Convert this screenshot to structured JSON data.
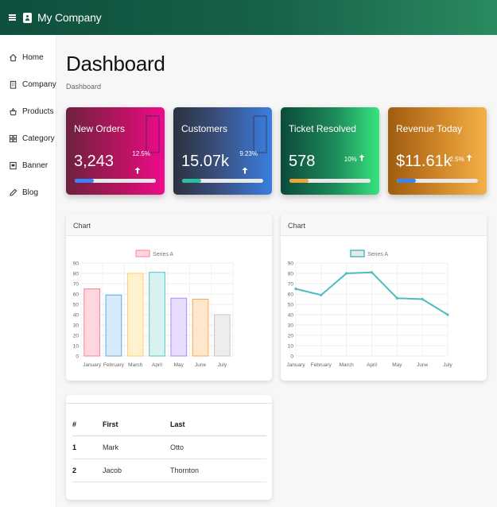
{
  "app": {
    "brand": "My Company"
  },
  "sidebar": {
    "items": [
      {
        "label": "Home",
        "icon": "home-icon"
      },
      {
        "label": "Company",
        "icon": "building-icon"
      },
      {
        "label": "Products",
        "icon": "basket-icon"
      },
      {
        "label": "Category",
        "icon": "grid-icon"
      },
      {
        "label": "Banner",
        "icon": "image-icon"
      },
      {
        "label": "Blog",
        "icon": "pencil-icon"
      }
    ]
  },
  "page": {
    "title": "Dashboard",
    "breadcrumb": "Dashboard"
  },
  "cards": [
    {
      "title": "New Orders",
      "value": "3,243",
      "change": "12.5%",
      "progress": 0.24,
      "bar_color": "#3b82f6"
    },
    {
      "title": "Customers",
      "value": "15.07k",
      "change": "9.23%",
      "progress": 0.24,
      "bar_color": "#2bbfa0"
    },
    {
      "title": "Ticket Resolved",
      "value": "578",
      "change": "10%",
      "progress": 0.24,
      "bar_color": "#f0a43a"
    },
    {
      "title": "Revenue Today",
      "value": "$11.61k",
      "change": "2.5%",
      "progress": 0.24,
      "bar_color": "#3b82f6"
    }
  ],
  "charts": {
    "panel_title": "Chart"
  },
  "chart_data": [
    {
      "type": "bar",
      "categories": [
        "January",
        "February",
        "March",
        "April",
        "May",
        "June",
        "July"
      ],
      "series": [
        {
          "name": "Series A",
          "values": [
            65,
            59,
            80,
            81,
            56,
            55,
            40
          ]
        }
      ],
      "ylim": [
        0,
        90
      ],
      "yticks": [
        0,
        10,
        20,
        30,
        40,
        50,
        60,
        70,
        80,
        90
      ],
      "grid": true,
      "legend": "top-center",
      "bar_colors": [
        "#ffd6dd",
        "#d6eafb",
        "#fff1cf",
        "#d7f2f1",
        "#e8ddff",
        "#ffe6cf",
        "#ededed"
      ],
      "bar_borders": [
        "#ff7f9a",
        "#5aaee8",
        "#ffcf66",
        "#56c5c4",
        "#a98bff",
        "#ffa94d",
        "#c7c7c7"
      ],
      "legend_fill": "#ffd6dd",
      "legend_border": "#ff7f9a"
    },
    {
      "type": "line",
      "categories": [
        "January",
        "February",
        "March",
        "April",
        "May",
        "June",
        "July"
      ],
      "series": [
        {
          "name": "Series A",
          "values": [
            65,
            59,
            80,
            81,
            56,
            55,
            40
          ]
        }
      ],
      "ylim": [
        0,
        90
      ],
      "yticks": [
        0,
        10,
        20,
        30,
        40,
        50,
        60,
        70,
        80,
        90
      ],
      "grid": true,
      "legend": "top-center",
      "line_color": "#4bbdc0",
      "legend_fill": "#e9e9e9",
      "legend_border": "#4bbdc0"
    }
  ],
  "table": {
    "headers": [
      "#",
      "First",
      "Last"
    ],
    "rows": [
      [
        "1",
        "Mark",
        "Otto"
      ],
      [
        "2",
        "Jacob",
        "Thornton"
      ]
    ]
  }
}
